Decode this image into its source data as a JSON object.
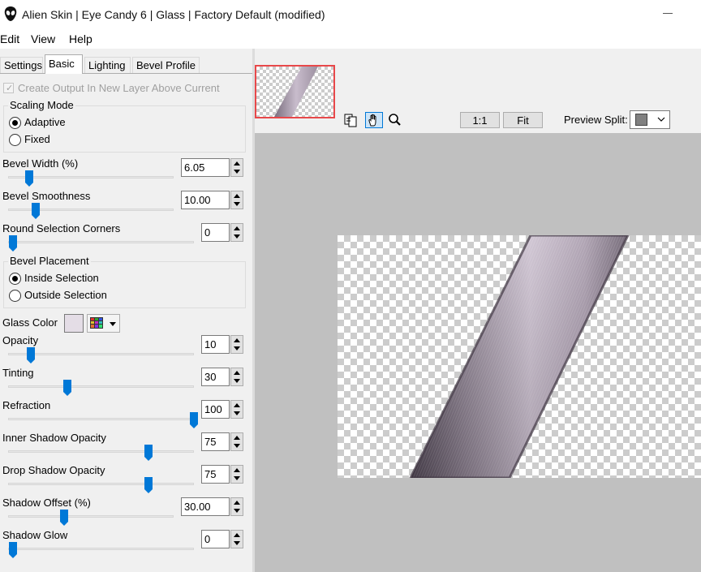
{
  "window": {
    "title": "Alien Skin | Eye Candy 6 | Glass | Factory Default (modified)"
  },
  "menu": [
    "Edit",
    "View",
    "Help"
  ],
  "tabs": [
    {
      "label": "Settings",
      "active": false
    },
    {
      "label": "Basic",
      "active": true
    },
    {
      "label": "Lighting",
      "active": false
    },
    {
      "label": "Bevel Profile",
      "active": false
    }
  ],
  "create_output": {
    "label": "Create Output In New Layer Above Current",
    "checked": true,
    "enabled": false
  },
  "scaling_mode": {
    "label": "Scaling Mode",
    "options": [
      "Adaptive",
      "Fixed"
    ],
    "selected": "Adaptive"
  },
  "bevel_width": {
    "label": "Bevel Width (%)",
    "value": "6.05",
    "level": 0.08
  },
  "bevel_smoothness": {
    "label": "Bevel Smoothness",
    "value": "10.00",
    "level": 0.12
  },
  "round_corners": {
    "label": "Round Selection Corners",
    "value": "0",
    "level": 0.0
  },
  "bevel_placement": {
    "label": "Bevel Placement",
    "options": [
      "Inside Selection",
      "Outside Selection"
    ],
    "selected": "Inside Selection"
  },
  "glass_color": {
    "label": "Glass Color",
    "color": "#e4dde6"
  },
  "opacity": {
    "label": "Opacity",
    "value": "10",
    "level": 0.1
  },
  "tinting": {
    "label": "Tinting",
    "value": "30",
    "level": 0.3
  },
  "refraction": {
    "label": "Refraction",
    "value": "100",
    "level": 1.0
  },
  "inner_shadow_opacity": {
    "label": "Inner Shadow Opacity",
    "value": "75",
    "level": 0.75
  },
  "drop_shadow_opacity": {
    "label": "Drop Shadow Opacity",
    "value": "75",
    "level": 0.75
  },
  "shadow_offset": {
    "label": "Shadow Offset (%)",
    "value": "30.00",
    "level": 0.3
  },
  "shadow_glow": {
    "label": "Shadow Glow",
    "value": "0",
    "level": 0.0
  },
  "preview": {
    "zoom_1to1_label": "1:1",
    "fit_label": "Fit",
    "split_label": "Preview Split:",
    "split_color": "#808080"
  },
  "colors": {
    "thumb": "#0078d7",
    "thumbnail_border": "#e8484a",
    "glass_light": "#c4b8c8",
    "glass_dark": "#6a5e6e"
  }
}
